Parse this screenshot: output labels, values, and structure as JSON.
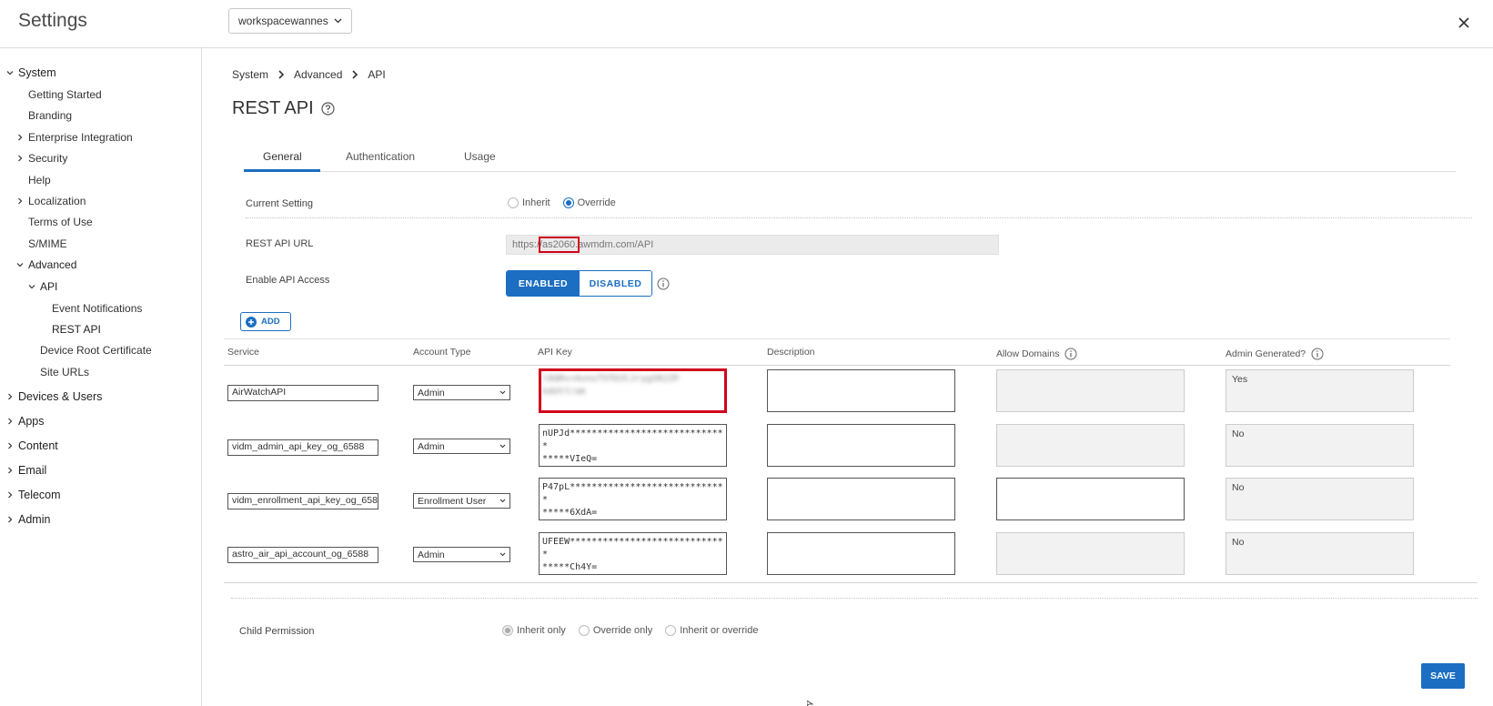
{
  "header": {
    "title": "Settings",
    "org_group": "workspacewannes"
  },
  "sidebar": {
    "items": [
      {
        "label": "System",
        "expanded": true
      },
      {
        "label": "Getting Started"
      },
      {
        "label": "Branding"
      },
      {
        "label": "Enterprise Integration",
        "expandable": true
      },
      {
        "label": "Security",
        "expandable": true
      },
      {
        "label": "Help"
      },
      {
        "label": "Localization",
        "expandable": true
      },
      {
        "label": "Terms of Use"
      },
      {
        "label": "S/MIME"
      },
      {
        "label": "Advanced",
        "expanded": true
      },
      {
        "label": "API",
        "expanded": true
      },
      {
        "label": "Event Notifications"
      },
      {
        "label": "REST API",
        "selected": true
      },
      {
        "label": "Device Root Certificate"
      },
      {
        "label": "Site URLs"
      },
      {
        "label": "Devices & Users",
        "expandable": true
      },
      {
        "label": "Apps",
        "expandable": true
      },
      {
        "label": "Content",
        "expandable": true
      },
      {
        "label": "Email",
        "expandable": true
      },
      {
        "label": "Telecom",
        "expandable": true
      },
      {
        "label": "Admin",
        "expandable": true
      }
    ]
  },
  "breadcrumb": [
    "System",
    "Advanced",
    "API"
  ],
  "page_title": "REST API",
  "tabs": [
    "General",
    "Authentication",
    "Usage"
  ],
  "current_setting": {
    "label": "Current Setting",
    "options": [
      "Inherit",
      "Override"
    ],
    "selected": "Override"
  },
  "rest_api_url": {
    "label": "REST API URL",
    "value": "https://as2060.awmdm.com/API"
  },
  "enable_api_access": {
    "label": "Enable API Access",
    "on_label": "ENABLED",
    "off_label": "DISABLED",
    "selected": "ENABLED"
  },
  "add_button": "ADD",
  "grid": {
    "columns": [
      "Service",
      "Account Type",
      "API Key",
      "Description",
      "Allow Domains",
      "Admin Generated?"
    ],
    "rows": [
      {
        "service": "AirWatchAPI",
        "account_type": "Admin",
        "api_key_line1": "l8QRv+AvnsT5TD2CJrygSR2ZP",
        "api_key_line2": "kAUtY/ak",
        "admin_generated": "Yes"
      },
      {
        "service": "vidm_admin_api_key_og_6588",
        "account_type": "Admin",
        "api_key_line1": "nUPJd*****************************",
        "api_key_line2": "*****VIeQ=",
        "admin_generated": "No"
      },
      {
        "service": "vidm_enrollment_api_key_og_6588",
        "account_type": "Enrollment User",
        "api_key_line1": "P47pL*****************************",
        "api_key_line2": "*****6XdA=",
        "admin_generated": "No"
      },
      {
        "service": "astro_air_api_account_og_6588",
        "account_type": "Admin",
        "api_key_line1": "UFEEW*****************************",
        "api_key_line2": "*****Ch4Y=",
        "admin_generated": "No"
      }
    ]
  },
  "child_permission": {
    "label": "Child Permission",
    "options": [
      "Inherit only",
      "Override only",
      "Inherit or override"
    ],
    "selected": "Inherit only"
  },
  "save_button": "SAVE",
  "colors": {
    "accent": "#1b6ec2",
    "highlight": "#d0021b"
  }
}
